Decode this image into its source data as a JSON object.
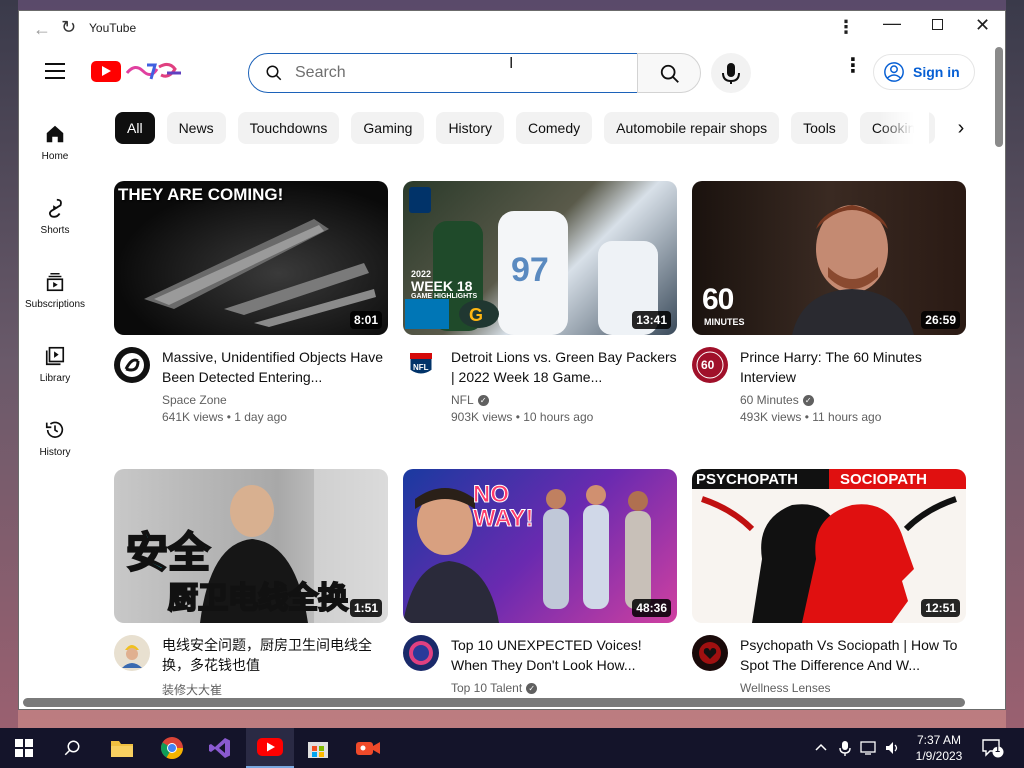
{
  "window": {
    "title": "YouTube"
  },
  "header": {
    "search_placeholder": "Search",
    "signin_label": "Sign in"
  },
  "leftnav": [
    {
      "label": "Home",
      "icon": "home-icon"
    },
    {
      "label": "Shorts",
      "icon": "shorts-icon"
    },
    {
      "label": "Subscriptions",
      "icon": "subscriptions-icon"
    },
    {
      "label": "Library",
      "icon": "library-icon"
    },
    {
      "label": "History",
      "icon": "history-icon"
    }
  ],
  "chips": [
    "All",
    "News",
    "Touchdowns",
    "Gaming",
    "History",
    "Comedy",
    "Automobile repair shops",
    "Tools",
    "Cooking"
  ],
  "videos": [
    {
      "title": "Massive, Unidentified Objects Have Been Detected Entering...",
      "channel": "Space Zone",
      "stats": "641K views • 1 day ago",
      "duration": "8:01",
      "thumb_text": "THEY ARE COMING!",
      "verified": false
    },
    {
      "title": "Detroit Lions vs. Green Bay Packers | 2022 Week 18 Game...",
      "channel": "NFL",
      "stats": "903K views • 10 hours ago",
      "duration": "13:41",
      "thumb_text": "WEEK 18",
      "thumb_sub": "GAME HIGHLIGHTS",
      "thumb_year": "2022",
      "verified": true
    },
    {
      "title": "Prince Harry: The 60 Minutes Interview",
      "channel": "60 Minutes",
      "stats": "493K views • 11 hours ago",
      "duration": "26:59",
      "thumb_text": "60",
      "thumb_sub": "MINUTES",
      "verified": true
    },
    {
      "title": "电线安全问题，厨房卫生间电线全换，多花钱也值",
      "channel": "装修大大崔",
      "stats": "",
      "duration": "1:51",
      "thumb_text": "安全",
      "thumb_sub": "厨卫电线全换",
      "verified": false
    },
    {
      "title": "Top 10 UNEXPECTED Voices! When They Don't Look How...",
      "channel": "Top 10 Talent",
      "stats": "",
      "duration": "48:36",
      "thumb_text": "NO WAY!",
      "verified": true
    },
    {
      "title": "Psychopath Vs Sociopath | How To Spot The Difference And W...",
      "channel": "Wellness Lenses",
      "stats": "",
      "duration": "12:51",
      "thumb_text": "PSYCHOPATH",
      "thumb_sub": "SOCIOPATH",
      "verified": false
    }
  ],
  "taskbar": {
    "time": "7:37 AM",
    "date": "1/9/2023",
    "notification_count": "1"
  },
  "colors": {
    "yt_red": "#ff0000",
    "link_blue": "#065fd4",
    "taskbar_bg": "#14142a"
  }
}
